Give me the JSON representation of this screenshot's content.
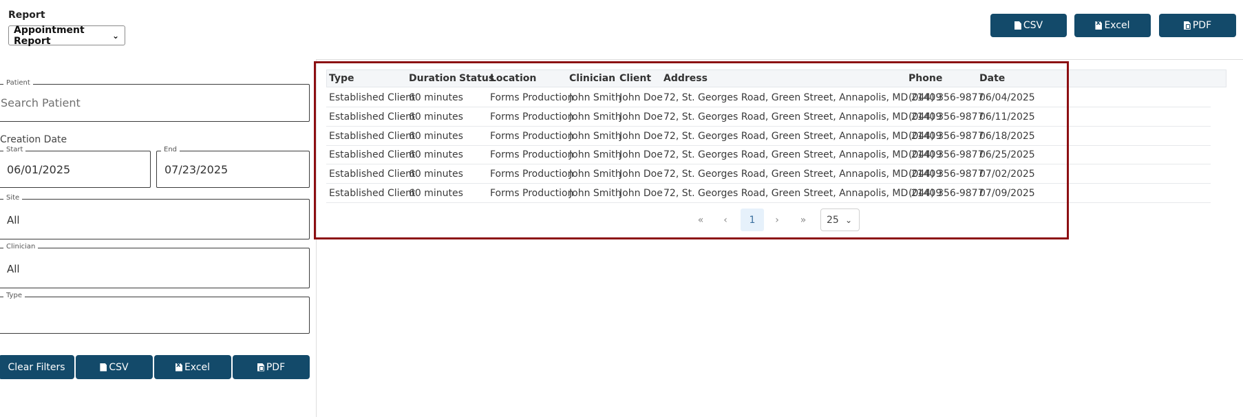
{
  "report": {
    "label": "Report",
    "selected": "Appointment Report"
  },
  "top_export": {
    "csv": "CSV",
    "excel": "Excel",
    "pdf": "PDF"
  },
  "filters": {
    "patient": {
      "legend": "Patient",
      "placeholder": "Search Patient"
    },
    "creation_date_label": "Creation Date",
    "start": {
      "legend": "Start",
      "value": "06/01/2025"
    },
    "end": {
      "legend": "End",
      "value": "07/23/2025"
    },
    "site": {
      "legend": "Site",
      "value": "All"
    },
    "clinician": {
      "legend": "Clinician",
      "value": "All"
    },
    "type": {
      "legend": "Type",
      "value": ""
    }
  },
  "bottom_buttons": {
    "clear": "Clear Filters",
    "csv": "CSV",
    "excel": "Excel",
    "pdf": "PDF"
  },
  "table": {
    "headers": [
      "Type",
      "Duration",
      "Status",
      "Location",
      "Clinician",
      "Client",
      "Address",
      "Phone",
      "Date"
    ],
    "rows": [
      [
        "Established Client",
        "60 minutes",
        "",
        "Forms Production",
        "John Smith",
        "John Doe",
        "72, St. Georges Road, Green Street, Annapolis, MD 21409",
        "(044) 356-9877",
        "06/04/2025"
      ],
      [
        "Established Client",
        "60 minutes",
        "",
        "Forms Production",
        "John Smith",
        "John Doe",
        "72, St. Georges Road, Green Street, Annapolis, MD 21409",
        "(044) 356-9877",
        "06/11/2025"
      ],
      [
        "Established Client",
        "60 minutes",
        "",
        "Forms Production",
        "John Smith",
        "John Doe",
        "72, St. Georges Road, Green Street, Annapolis, MD 21409",
        "(044) 356-9877",
        "06/18/2025"
      ],
      [
        "Established Client",
        "60 minutes",
        "",
        "Forms Production",
        "John Smith",
        "John Doe",
        "72, St. Georges Road, Green Street, Annapolis, MD 21409",
        "(044) 356-9877",
        "06/25/2025"
      ],
      [
        "Established Client",
        "60 minutes",
        "",
        "Forms Production",
        "John Smith",
        "John Doe",
        "72, St. Georges Road, Green Street, Annapolis, MD 21409",
        "(044) 356-9877",
        "07/02/2025"
      ],
      [
        "Established Client",
        "60 minutes",
        "",
        "Forms Production",
        "John Smith",
        "John Doe",
        "72, St. Georges Road, Green Street, Annapolis, MD 21409",
        "(044) 356-9877",
        "07/09/2025"
      ]
    ]
  },
  "pagination": {
    "first": "«",
    "prev": "‹",
    "current_page": "1",
    "next": "›",
    "last": "»",
    "page_size": "25"
  },
  "colors": {
    "button_bg": "#134a6a",
    "highlight": "#8c0e12",
    "current_page_bg": "#e6f1fb"
  }
}
